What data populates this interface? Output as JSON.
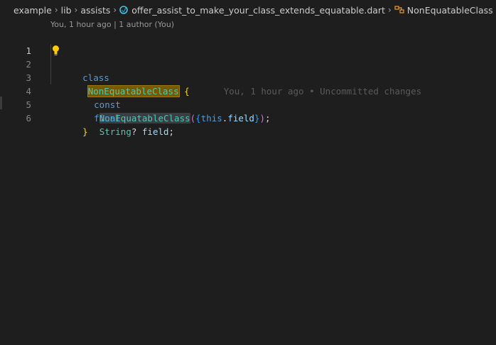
{
  "breadcrumb": {
    "items": [
      "example",
      "lib",
      "assists"
    ],
    "file": "offer_assist_to_make_your_class_extends_equatable.dart",
    "symbol": "NonEquatableClass"
  },
  "codelens": "You, 1 hour ago | 1 author (You)",
  "lines": {
    "n1": "1",
    "n2": "2",
    "n3": "3",
    "n4": "4",
    "n5": "5",
    "n6": "6"
  },
  "code": {
    "kw_class": "class",
    "class_name": "NonEquatableClass",
    "open_brace": "{",
    "kw_const": "const",
    "ctor_name": "NonEquatableClass",
    "paren_open": "(",
    "brace_open": "{",
    "kw_this": "this",
    "dot": ".",
    "field_ref": "field",
    "brace_close": "}",
    "paren_close": ")",
    "semicolon": ";",
    "kw_final": "final",
    "type": "String",
    "nullable": "?",
    "field_name": "field",
    "semicolon2": ";",
    "close_brace": "}"
  },
  "blame": "You, 1 hour ago • Uncommitted changes",
  "colors": {
    "background": "#1e1e1e",
    "keyword": "#569cd6",
    "type": "#4ec9b0",
    "variable": "#9cdcfe",
    "highlight": "#7a5a00"
  }
}
